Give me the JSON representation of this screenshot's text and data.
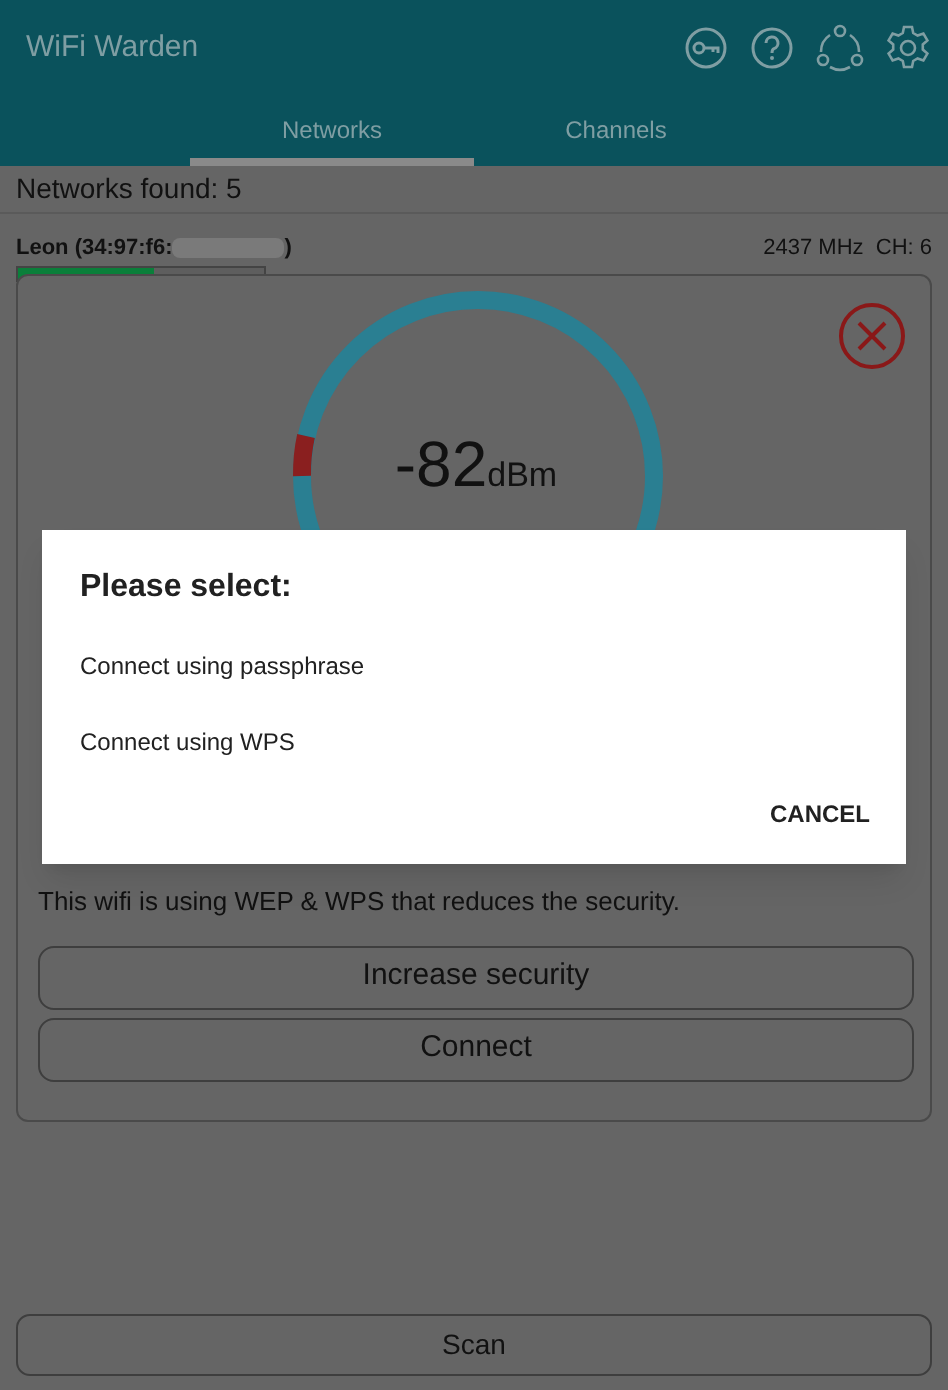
{
  "app_bar": {
    "title": "WiFi Warden"
  },
  "tabs": [
    {
      "label": "Networks",
      "selected": true
    },
    {
      "label": "Channels",
      "selected": false
    }
  ],
  "networks_found": "Networks found: 5",
  "network": {
    "name": "Leon (34:97:f6:",
    "name_end": ")",
    "level": 0.55,
    "frequency": "2437 MHz  CH: 6"
  },
  "detail": {
    "signal": "-82",
    "unit": "dBm",
    "warning": "This wifi is using WEP & WPS that reduces the security.",
    "buttons": [
      "Increase security",
      "Connect"
    ]
  },
  "dialog": {
    "title": "Please select:",
    "options": [
      "Connect using passphrase",
      "Connect using WPS"
    ],
    "cancel": "CANCEL"
  },
  "scan_button": "Scan"
}
